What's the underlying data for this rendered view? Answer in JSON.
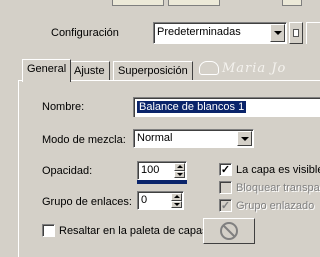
{
  "config": {
    "label": "Configuración",
    "preset_value": "Predeterminadas"
  },
  "tabs": [
    {
      "label": "General"
    },
    {
      "label": "Ajuste"
    },
    {
      "label": "Superposición"
    }
  ],
  "watermark": "Maria Jo",
  "form": {
    "nombre_label": "Nombre:",
    "nombre_value": "Balance de blancos 1",
    "modo_label": "Modo de mezcla:",
    "modo_value": "Normal",
    "opacidad_label": "Opacidad:",
    "opacidad_value": "100",
    "grupo_label": "Grupo de enlaces:",
    "grupo_value": "0",
    "resaltar_label": "Resaltar en la paleta de capas:"
  },
  "checks": {
    "visible_label": "La capa es visible",
    "visible_checked": true,
    "bloquear_label": "Bloquear transpa",
    "bloquear_checked": false,
    "grupo_enlazado_label": "Grupo enlazado",
    "grupo_enlazado_checked": true,
    "resaltar_checked": false
  },
  "colors": {
    "selection": "#0a246a",
    "opacity_bar": "#0a246a"
  }
}
